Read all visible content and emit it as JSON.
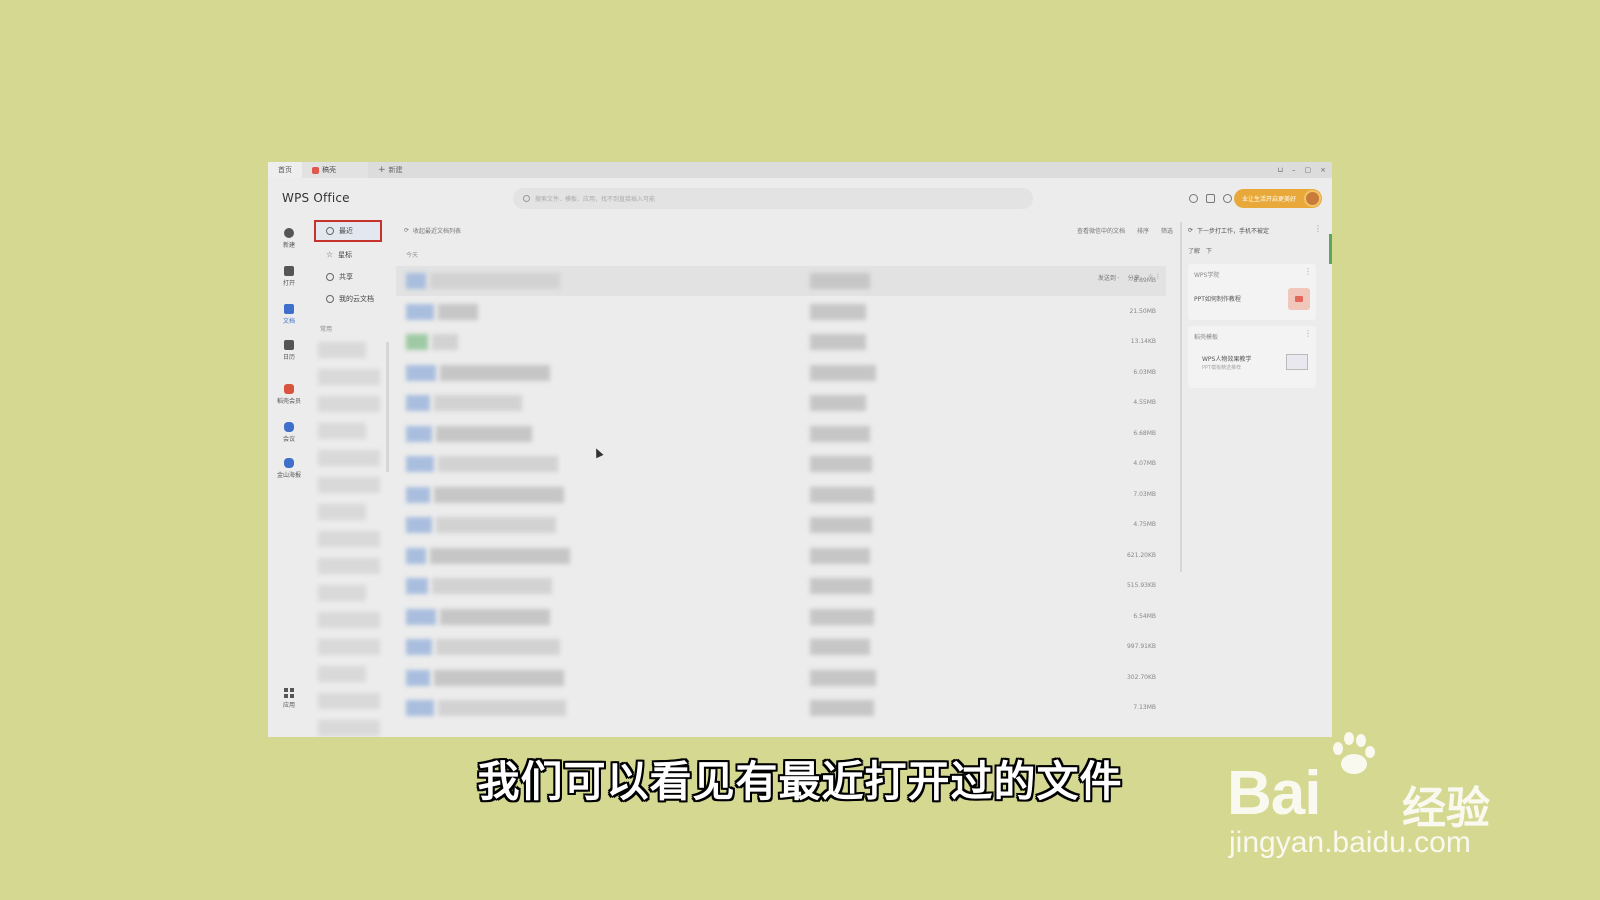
{
  "tabs": {
    "home": "首页",
    "doc": "稿壳",
    "new": "新建"
  },
  "window_controls": [
    "⊔",
    "–",
    "▢",
    "×"
  ],
  "app": {
    "logo": "WPS Office"
  },
  "search": {
    "placeholder": "搜索文件、模板、应用，找不到直接插入可能"
  },
  "header": {
    "member_label": "业让生活开启更美好"
  },
  "leftnav": [
    {
      "label": "新建",
      "icon": "plus-icon"
    },
    {
      "label": "打开",
      "icon": "folder-icon"
    },
    {
      "label": "文档",
      "icon": "document-icon"
    },
    {
      "label": "日历",
      "icon": "calendar-icon"
    },
    {
      "label": "稻壳会员",
      "icon": "docer-icon"
    },
    {
      "label": "会议",
      "icon": "meeting-icon"
    },
    {
      "label": "金山海报",
      "icon": "poster-icon"
    },
    {
      "label": "应用",
      "icon": "apps-icon"
    }
  ],
  "subnav": [
    {
      "label": "最近",
      "icon": "clock-icon"
    },
    {
      "label": "星标",
      "icon": "star-icon"
    },
    {
      "label": "共享",
      "icon": "share-icon"
    },
    {
      "label": "我的云文档",
      "icon": "cloud-icon"
    }
  ],
  "subnav_section": "常用",
  "content": {
    "top_hint": "收起最近文档列表",
    "tools": [
      "查看微信中的文档",
      "排序",
      "筛选"
    ],
    "section": "今天",
    "row_actions": [
      "发送到 ·",
      "分享",
      "☆ ⋮"
    ]
  },
  "files": [
    {
      "size": "8.89MB"
    },
    {
      "size": "21.50MB"
    },
    {
      "size": "13.14KB"
    },
    {
      "size": "6.03MB"
    },
    {
      "size": "4.55MB"
    },
    {
      "size": "6.68MB"
    },
    {
      "size": "4.07MB"
    },
    {
      "size": "7.03MB"
    },
    {
      "size": "4.75MB"
    },
    {
      "size": "621.20KB"
    },
    {
      "size": "515.93KB"
    },
    {
      "size": "6.54MB"
    },
    {
      "size": "997.91KB"
    },
    {
      "size": "302.70KB"
    },
    {
      "size": "7.13MB"
    }
  ],
  "rpanel": {
    "title": "下一步打工作，手机不被定",
    "links": [
      "了解",
      "下"
    ],
    "card1": {
      "head": "WPS学院",
      "text": "PPT如何制作教程"
    },
    "card2": {
      "head": "稻壳模板",
      "text": "WPS人物效果教学",
      "sub": "PPT模板精选推荐"
    }
  },
  "subtitle": "我们可以看见有最近打开过的文件",
  "watermark": {
    "word": "Bai",
    "jy": "经验",
    "url": "jingyan.baidu.com"
  }
}
